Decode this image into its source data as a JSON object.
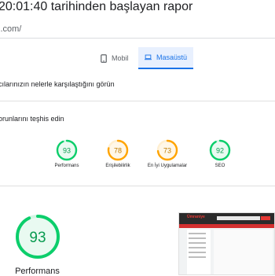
{
  "header": {
    "report_title": "20:01:40 tarihinden başlayan rapor",
    "url": "i.com/"
  },
  "tabs": {
    "mobile_label": "Mobil",
    "desktop_label": "Masaüstü",
    "selected": "Masaüstü"
  },
  "sections": {
    "field_data_text": "cılarınızın nelerle karşılaştığını görün",
    "diagnose_text": "orunlarını teşhis edin"
  },
  "scores": [
    {
      "label": "Performans",
      "value": "93",
      "color": "#0cce6b"
    },
    {
      "label": "Erişilebilirlik",
      "value": "78",
      "color": "#ffa400"
    },
    {
      "label": "En İyi Uygulamalar",
      "value": "73",
      "color": "#ffa400"
    },
    {
      "label": "SEO",
      "value": "92",
      "color": "#0cce6b"
    }
  ],
  "performance": {
    "value": "93",
    "label": "Performans",
    "color": "#0cce6b"
  },
  "screenshot": {
    "logo_text": "Ümraniye"
  },
  "colors": {
    "pass": "#0cce6b",
    "average": "#ffa400",
    "accent": "#1a73e8"
  }
}
